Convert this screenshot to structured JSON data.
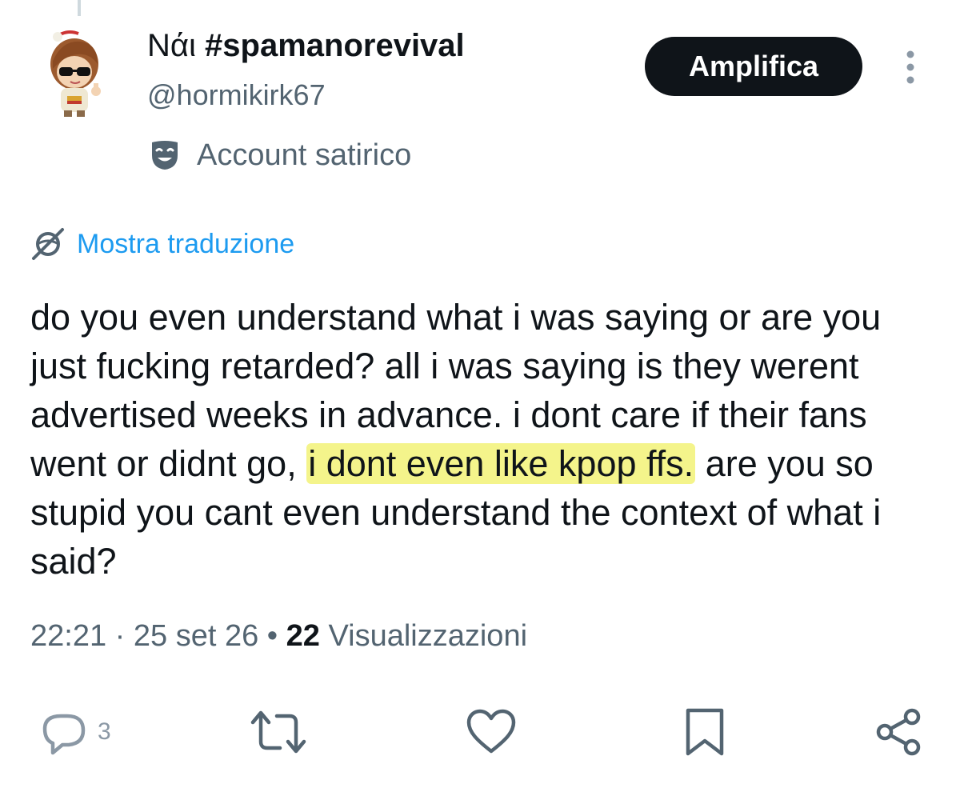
{
  "tweet": {
    "author": {
      "name_prefix": "Nάι",
      "name_hashtag": "#spamanorevival",
      "handle": "@hormikirk67",
      "label": "Account satirico"
    },
    "follow_button": "Amplifica",
    "translate_link": "Mostra traduzione",
    "text": {
      "before_highlight": "do you even understand what i was saying or are you just fucking retarded? all i was saying is they werent advertised weeks in advance. i dont care if their fans went or didnt go, ",
      "highlighted": "i dont even like kpop ffs.",
      "after_highlight": " are you so stupid you cant even understand the context of what i said?"
    },
    "meta": {
      "time": "22:21",
      "sep1": " · ",
      "date": "25 set 26",
      "sep2": " • ",
      "views_count": "22",
      "views_label": " Visualizzazioni"
    },
    "actions": {
      "reply_count": "3"
    }
  },
  "colors": {
    "text": "#0f1419",
    "secondary": "#536471",
    "link": "#1d9bf0",
    "highlight": "#f0f064"
  },
  "icons": [
    "comedy-mask-icon",
    "translate-icon",
    "more-icon",
    "reply-icon",
    "retweet-icon",
    "like-icon",
    "bookmark-icon",
    "share-icon"
  ]
}
